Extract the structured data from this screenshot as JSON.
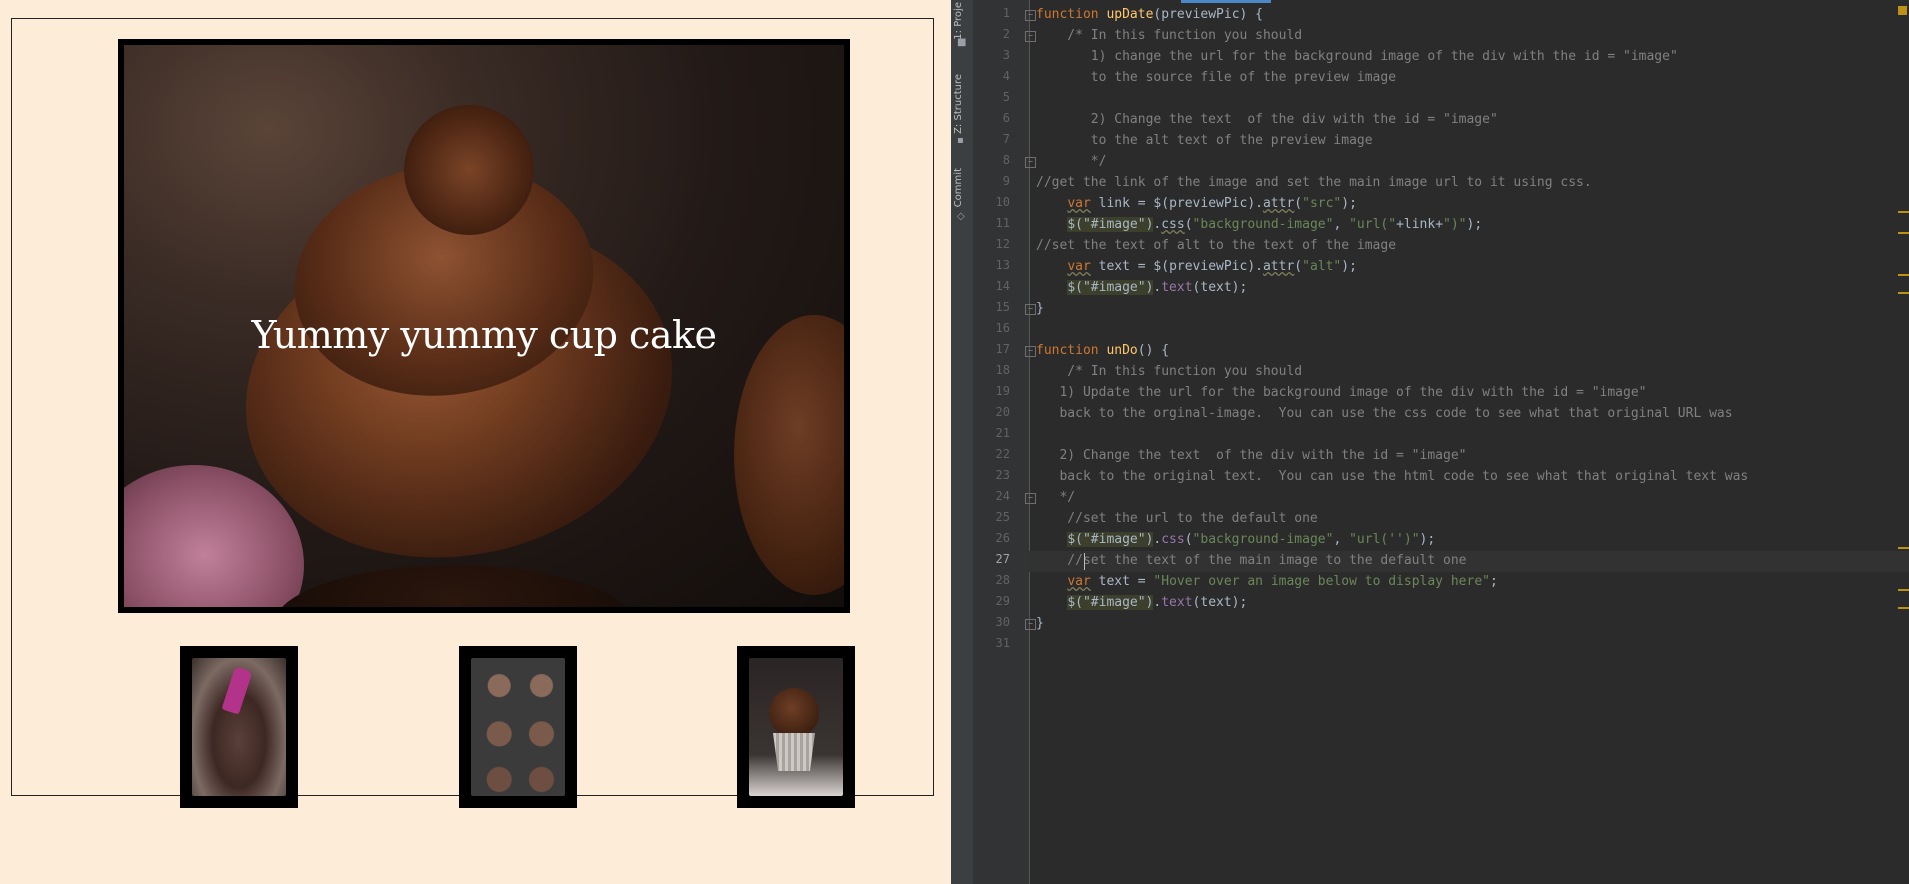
{
  "preview": {
    "main_caption": "Yummy yummy cup cake",
    "thumbnails": [
      {
        "label": "chocolate-batter-bowl"
      },
      {
        "label": "cupcake-tin"
      },
      {
        "label": "frosted-cupcake"
      }
    ]
  },
  "ide": {
    "tool_tabs": [
      "1: Proje",
      "Z: Structure",
      "Commit"
    ],
    "current_line": 27,
    "line_numbers": [
      "1",
      "2",
      "3",
      "4",
      "5",
      "6",
      "7",
      "8",
      "9",
      "10",
      "11",
      "12",
      "13",
      "14",
      "15",
      "16",
      "17",
      "18",
      "19",
      "20",
      "21",
      "22",
      "23",
      "24",
      "25",
      "26",
      "27",
      "28",
      "29",
      "30",
      "31"
    ],
    "code": {
      "l1_kw": "function",
      "l1_fn": "upDate",
      "l1_rest": "(previewPic) {",
      "l2": "    /* In this function you should",
      "l3": "       1) change the url for the background image of the div with the id = \"image\"",
      "l4": "       to the source file of the preview image",
      "l6": "       2) Change the text  of the div with the id = \"image\"",
      "l7": "       to the alt text of the preview image",
      "l8": "       */",
      "l9": "//get the link of the image and set the main image url to it using css.",
      "l10_kw": "var",
      "l10_a": " link = $(previewPic).",
      "l10_m": "attr",
      "l10_b": "(",
      "l10_s": "\"src\"",
      "l10_c": ");",
      "l11_jq": "$(\"#image\")",
      "l11_a": ".",
      "l11_m": "css",
      "l11_b": "(",
      "l11_s1": "\"background-image\"",
      "l11_c": ", ",
      "l11_s2": "\"url(\"",
      "l11_d": "+link+",
      "l11_s3": "\")\"",
      "l11_e": ");",
      "l12": "//set the text of alt to the text of the image",
      "l13_kw": "var",
      "l13_a": " text = $(previewPic).",
      "l13_m": "attr",
      "l13_b": "(",
      "l13_s": "\"alt\"",
      "l13_c": ");",
      "l14_jq": "$(\"#image\")",
      "l14_a": ".",
      "l14_m": "text",
      "l14_b": "(text);",
      "l15": "}",
      "l17_kw": "function",
      "l17_fn": "unDo",
      "l17_rest": "() {",
      "l18": "    /* In this function you should",
      "l19": "   1) Update the url for the background image of the div with the id = \"image\"",
      "l20": "   back to the orginal-image.  You can use the css code to see what that original URL was",
      "l22": "   2) Change the text  of the div with the id = \"image\"",
      "l23": "   back to the original text.  You can use the html code to see what that original text was",
      "l24": "   */",
      "l25": "    //set the url to the default one",
      "l26_jq": "$(\"#image\")",
      "l26_a": ".",
      "l26_m": "css",
      "l26_b": "(",
      "l26_s1": "\"background-image\"",
      "l26_c": ", ",
      "l26_s2": "\"url('')\"",
      "l26_d": ");",
      "l27": "    //set the text of the main image to the default one",
      "l28_kw": "var",
      "l28_a": " text = ",
      "l28_s": "\"Hover over an image below to display here\"",
      "l28_b": ";",
      "l29_jq": "$(\"#image\")",
      "l29_a": ".",
      "l29_m": "text",
      "l29_b": "(text);",
      "l30": "}"
    }
  }
}
